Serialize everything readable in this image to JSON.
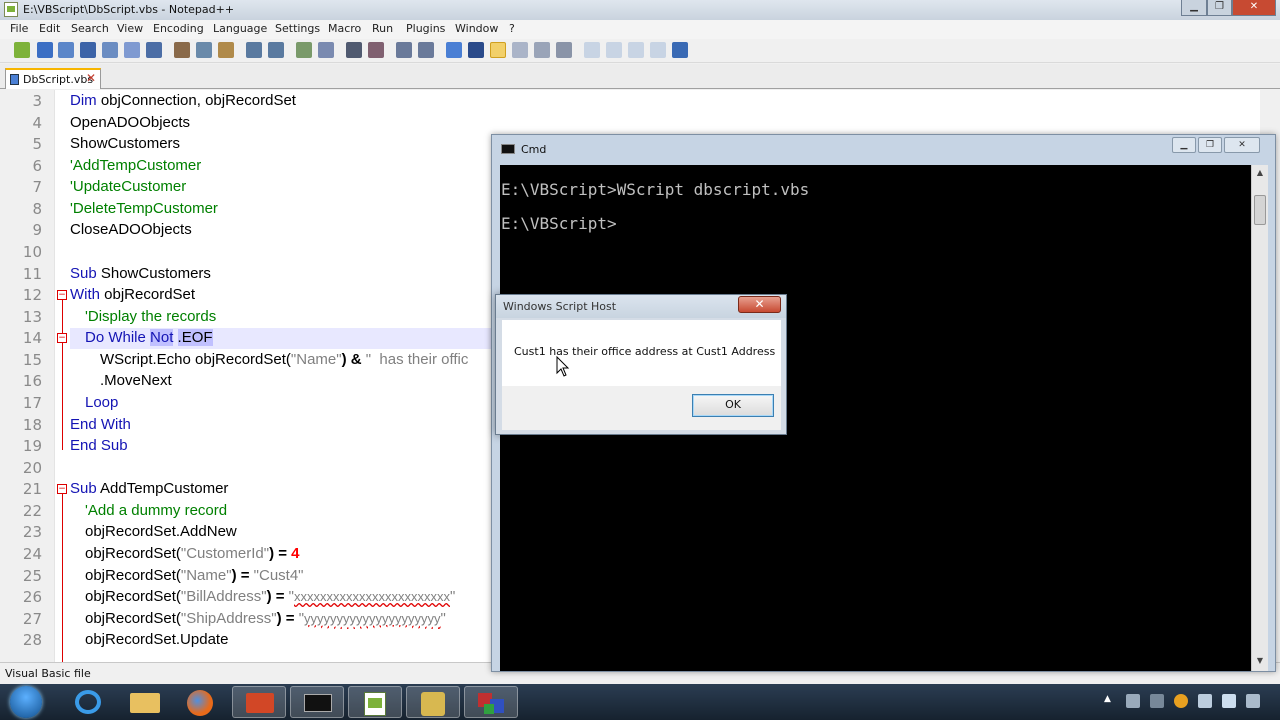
{
  "npp": {
    "title": "E:\\VBScript\\DbScript.vbs - Notepad++",
    "menu": [
      "File",
      "Edit",
      "Search",
      "View",
      "Encoding",
      "Language",
      "Settings",
      "Macro",
      "Run",
      "Plugins",
      "Window",
      "?"
    ],
    "tab_label": "DbScript.vbs",
    "tab_close": "✕",
    "status": "Visual Basic file",
    "line_numbers": [
      "3",
      "4",
      "5",
      "6",
      "7",
      "8",
      "9",
      "10",
      "11",
      "12",
      "13",
      "14",
      "15",
      "16",
      "17",
      "18",
      "19",
      "20",
      "21",
      "22",
      "23",
      "24",
      "25",
      "26",
      "27",
      "28"
    ],
    "lines": {
      "l3a": "Dim",
      "l3b": " objConnection, objRecordSet",
      "l4": "OpenADOObjects",
      "l5": "ShowCustomers",
      "l6": "'AddTempCustomer",
      "l7": "'UpdateCustomer",
      "l8": "'DeleteTempCustomer",
      "l9": "CloseADOObjects",
      "l11a": "Sub",
      "l11b": " ShowCustomers",
      "l12a": "With",
      "l12b": " objRecordSet",
      "l13": "'Display the records",
      "l14a": "Do While",
      "l14b": "Not",
      "l14c": ".EOF",
      "l15a": "WScript.Echo objRecordSet(",
      "l15b": "\"Name\"",
      "l15c": ") & ",
      "l15d": "\"  has their offic",
      "l16": ".MoveNext",
      "l17": "Loop",
      "l18": "End With",
      "l19": "End Sub",
      "l21a": "Sub",
      "l21b": " AddTempCustomer",
      "l22": "'Add a dummy record",
      "l23": "objRecordSet.AddNew",
      "l24a": "objRecordSet(",
      "l24b": "\"CustomerId\"",
      "l24c": ") = ",
      "l24d": "4",
      "l25a": "objRecordSet(",
      "l25b": "\"Name\"",
      "l25c": ") = ",
      "l25d": "\"Cust4\"",
      "l26a": "objRecordSet(",
      "l26b": "\"BillAddress\"",
      "l26c": ") = ",
      "l26d": "\"",
      "l26e": "xxxxxxxxxxxxxxxxxxxxxxxx",
      "l26f": "\"",
      "l27a": "objRecordSet(",
      "l27b": "\"ShipAddress\"",
      "l27c": ") = ",
      "l27d": "\"",
      "l27e": "yyyyyyyyyyyyyyyyyyyyy",
      "l27f": "\"",
      "l28": "objRecordSet.Update"
    }
  },
  "cmd": {
    "title": "Cmd",
    "line1": "E:\\VBScript>WScript dbscript.vbs",
    "line2": "E:\\VBScript>"
  },
  "msgbox": {
    "title": "Windows Script Host",
    "close": "✕",
    "text": "Cust1  has their office address at Cust1 Address",
    "ok": "OK"
  },
  "icons": [
    "windows-start-orb",
    "internet-explorer-icon",
    "file-explorer-icon",
    "firefox-icon",
    "powerpoint-icon",
    "cmd-icon",
    "notepad-plus-plus-icon",
    "tools-icon",
    "database-icon"
  ]
}
